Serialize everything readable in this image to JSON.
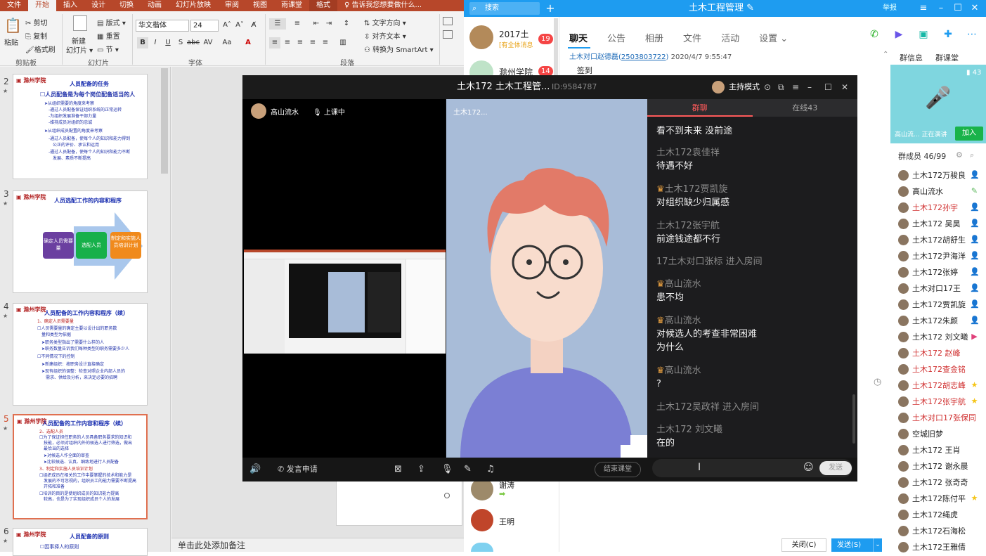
{
  "ppt": {
    "tabs": [
      "文件",
      "开始",
      "插入",
      "设计",
      "切换",
      "动画",
      "幻灯片放映",
      "审阅",
      "视图",
      "雨课堂",
      "格式",
      "告诉我您想要做什么..."
    ],
    "ribbon": {
      "paste": "粘贴",
      "cut": "剪切",
      "copy": "复制",
      "format_painter": "格式刷",
      "clipboard": "剪贴板",
      "new_slide": "新建",
      "new_slide2": "幻灯片 ▾",
      "layout": "版式 ▾",
      "reset": "重置",
      "section": "节 ▾",
      "slides": "幻灯片",
      "font_name": "华文楷体",
      "font_size": "24",
      "font": "字体",
      "text_direction": "文字方向 ▾",
      "align_text": "对齐文本 ▾",
      "smartart": "转换为 SmartArt ▾",
      "paragraph": "段落"
    },
    "slides": [
      {
        "num": "2",
        "title": "人员配备的任务",
        "lines": [
          "☐人员配备是为每个岗位配备适当的人",
          "➤从组织需要的角度来考察",
          "-通过人员配备保证组织系统的正常运转",
          "-为组织发展准备干部力量",
          "-维持成员对组织的忠诚",
          "➤从组织成员配置的角度来考察",
          "-通过人员配备，使每个人的知识和能力得到",
          "公正的评价、承认和运用",
          "-通过人员配备，使每个人的知识和能力不断",
          "发展、素质不断提高"
        ]
      },
      {
        "num": "3",
        "title": "人员选配工作的内容和程序",
        "boxes": [
          "确定人员需要量",
          "选配人员",
          "制定和实施人员培训计划"
        ]
      },
      {
        "num": "4",
        "title": "人员配备的工作内容和程序（续）",
        "lines": [
          "1、确定人员需要量",
          "☐人员需要量的确定主要以设计出的职务数",
          "量和类型为依据",
          "➤职务类型指出了需要什么样的人",
          "➤职务数量告诉我们每种类型的职务需要多少人",
          "☐不同情况下的控制",
          "➤新建组织：按职务设计直接确定",
          "➤现有组织的调整：检查对照企业内部人员的",
          "需求、供给及分析，来决定必要的招聘"
        ]
      },
      {
        "num": "5",
        "title": "人员配备的工作内容和程序（续）",
        "lines": [
          "2、选配人员",
          "☐为了保证担任职务的人员具备职务要求的知识和",
          "技能，必须对组织内外的候选人进行筛选，做出",
          "最恰当的选择",
          "➤对候选人作全面的审查",
          "➤比较候选、认真、细致地进行人员配备",
          "3、制定和实施人员培训计划",
          "☐组织成员在相关的工作中要掌握的技术和能力是",
          "发展的不可忽视的，组织员工的能力需要不断提高",
          "开拓和准备",
          "☐培训的目的是使组织成员的知识能力提高",
          "较高，也是为了实现组织成员个人的发展"
        ]
      },
      {
        "num": "6",
        "title": "人员配备的原则",
        "lines": [
          "☐因事择人的原则"
        ]
      }
    ],
    "notes": "单击此处添加备注"
  },
  "qq": {
    "search": "搜索",
    "title": "土木工程管理 ✎",
    "report": "举报",
    "conversations": [
      {
        "name": "2017土",
        "sub": "[有全体消息",
        "badge": "19"
      },
      {
        "name": "滁州学院",
        "sub": "",
        "badge": "14"
      }
    ],
    "chat_tabs": [
      "聊天",
      "公告",
      "相册",
      "文件",
      "活动",
      "设置 ⌄"
    ],
    "first_msg": {
      "sender": "土木对口赵德磊",
      "qq": "2503803722",
      "time": "2020/4/7 9:55:47",
      "text": "签到"
    },
    "bottom_msgs": [
      {
        "name": "谢涛"
      },
      {
        "name": "王明"
      }
    ],
    "close_btn": "关闭(C)",
    "send_btn": "发送(S)",
    "group_tabs": [
      "群信息",
      "群课堂"
    ],
    "voice_status": "高山流... 正在演讲",
    "voice_count": "43",
    "join": "加入",
    "members_header": "群成员 46/99",
    "members": [
      {
        "name": "土木172万骏良",
        "red": false
      },
      {
        "name": "高山流水",
        "red": false
      },
      {
        "name": "土木172孙宇",
        "red": true
      },
      {
        "name": "土木172 吴昊",
        "red": false
      },
      {
        "name": "土木172胡舒生",
        "red": false
      },
      {
        "name": "土木172尹海洋",
        "red": false
      },
      {
        "name": "土木172张婷",
        "red": false
      },
      {
        "name": "土木对口17王",
        "red": false
      },
      {
        "name": "土木172贾凯旋",
        "red": false
      },
      {
        "name": "土木172朱颜",
        "red": false
      },
      {
        "name": "土木172 刘文曦",
        "red": false
      },
      {
        "name": "土木172 赵峰",
        "red": true
      },
      {
        "name": "土木172查金铭",
        "red": true
      },
      {
        "name": "土木172胡志峰",
        "red": true
      },
      {
        "name": "土木172张宇航",
        "red": true
      },
      {
        "name": "土木对口17张保同",
        "red": true
      },
      {
        "name": "空城旧梦",
        "red": false
      },
      {
        "name": "土木172 王肖",
        "red": false
      },
      {
        "name": "土木172 谢永晨",
        "red": false
      },
      {
        "name": "土木172 张奇奇",
        "red": false
      },
      {
        "name": "土木172陈付平",
        "red": false
      },
      {
        "name": "土木172绳虎",
        "red": false
      },
      {
        "name": "土木172石海松",
        "red": false
      },
      {
        "name": "土木172王雅倩",
        "red": false
      }
    ]
  },
  "classroom": {
    "title": "土木172 土木工程管...",
    "id": "ID:9584787",
    "mode": "主持模式",
    "teacher": "高山流水",
    "status": "上课中",
    "right_label": "土木172...",
    "chat_tab": "群聊",
    "online_tab": "在线43",
    "messages": [
      {
        "name": "",
        "text": "看不到未来  没前途",
        "sys": false,
        "crown": false
      },
      {
        "name": "土木172袁佳祥",
        "text": "待遇不好",
        "sys": false,
        "crown": false
      },
      {
        "name": "土木172贾凯旋",
        "text": "对组织缺少归属感",
        "sys": false,
        "crown": true
      },
      {
        "name": "土木172张宇航",
        "text": "前途钱途都不行",
        "sys": false,
        "crown": false
      },
      {
        "name": "",
        "text": "17土木对口张标 进入房间",
        "sys": true,
        "crown": false
      },
      {
        "name": "高山流水",
        "text": "患不均",
        "sys": false,
        "crown": true
      },
      {
        "name": "高山流水",
        "text": "对候选人的考查非常困难",
        "text2": "为什么",
        "sys": false,
        "crown": true
      },
      {
        "name": "高山流水",
        "text": "?",
        "sys": false,
        "crown": true
      },
      {
        "name": "",
        "text": "土木172吴政祥 进入房间",
        "sys": true,
        "crown": false
      },
      {
        "name": "土木172 刘文曦",
        "text": "在的",
        "sys": false,
        "crown": false
      }
    ],
    "apply_speak": "发言申请",
    "end_class": "结束课堂",
    "send": "发送"
  },
  "colors": {
    "ppt_red": "#b7472a",
    "qq_blue": "#1e9cf0",
    "avatar_bg": "#a8bcd8",
    "hair": "#e27a68",
    "shirt": "#7b7fd4"
  }
}
